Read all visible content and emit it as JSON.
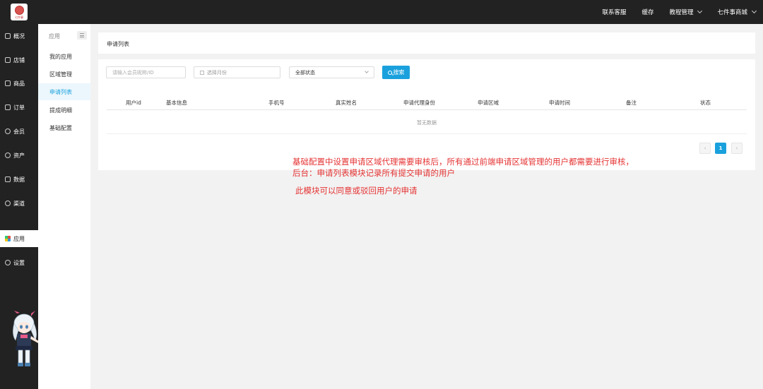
{
  "logo": {
    "text": "七件事"
  },
  "top_nav": [
    {
      "label": "联系客服",
      "has_dropdown": false
    },
    {
      "label": "缓存",
      "has_dropdown": false
    },
    {
      "label": "教程管理",
      "has_dropdown": true
    },
    {
      "label": "七件事商城",
      "has_dropdown": true
    }
  ],
  "sidebar": {
    "items": [
      {
        "label": "概况",
        "icon": "monitor-icon"
      },
      {
        "label": "店铺",
        "icon": "shop-icon"
      },
      {
        "label": "商品",
        "icon": "goods-icon"
      },
      {
        "label": "订单",
        "icon": "order-icon"
      },
      {
        "label": "会员",
        "icon": "user-icon"
      },
      {
        "label": "资产",
        "icon": "coin-icon"
      },
      {
        "label": "数据",
        "icon": "chart-icon"
      },
      {
        "label": "渠道",
        "icon": "share-icon"
      },
      {
        "label": "应用",
        "icon": "apps-icon",
        "active": true
      },
      {
        "label": "设置",
        "icon": "gear-icon"
      }
    ]
  },
  "submenu": {
    "header": "应用",
    "items": [
      {
        "label": "我的应用"
      },
      {
        "label": "区域管理"
      },
      {
        "label": "申请列表",
        "active": true
      },
      {
        "label": "提成明细"
      },
      {
        "label": "基础配置"
      }
    ]
  },
  "breadcrumb": "申请列表",
  "filters": {
    "member_placeholder": "请输入会员昵称/ID",
    "month_placeholder": "选择月份",
    "status_selected": "全部状态",
    "search_label": "搜索"
  },
  "table": {
    "headers": [
      "用户id",
      "基本信息",
      "手机号",
      "真实姓名",
      "申请代理身份",
      "申请区域",
      "申请时间",
      "备注",
      "状态"
    ],
    "empty_text": "暂无数据"
  },
  "pagination": {
    "current": "1",
    "prev": "‹",
    "next": "›"
  },
  "annotations": [
    "基础配置中设置申请区域代理需要审核后，所有通过前端申请区域管理的用户都需要进行审核，",
    "后台：申请列表模块记录所有提交申请的用户",
    "此模块可以同意或驳回用户的申请"
  ],
  "colors": {
    "accent": "#1aa1dd",
    "dark": "#222222",
    "note_red": "#e53333"
  }
}
